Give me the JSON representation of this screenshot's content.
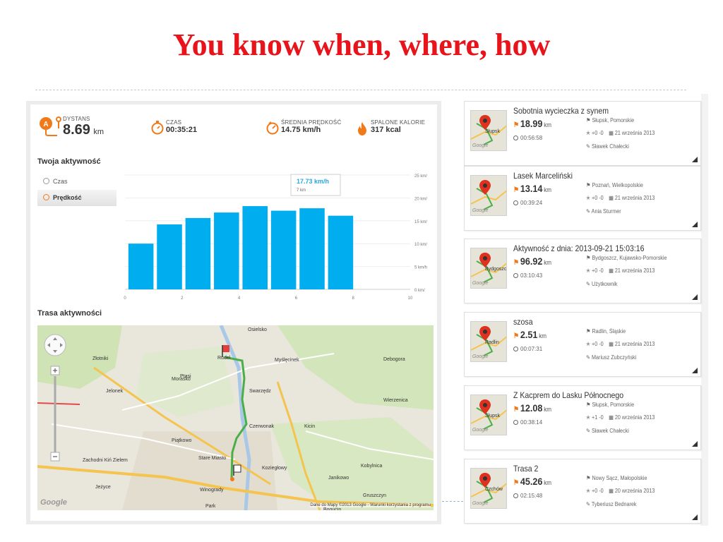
{
  "slide": {
    "title": "You know when, where, how"
  },
  "stats": {
    "distance": {
      "label": "DYSTANS",
      "value": "8.69",
      "unit": "km"
    },
    "time": {
      "label": "CZAS",
      "value": "00:35:21"
    },
    "avg_speed": {
      "label": "ŚREDNIA PRĘDKOŚĆ",
      "value": "14.75 km/h"
    },
    "calories": {
      "label": "SPALONE KALORIE",
      "value": "317 kcal"
    }
  },
  "activity": {
    "section_title": "Twoja aktywność",
    "tabs": [
      {
        "label": "Czas"
      },
      {
        "label": "Prędkość"
      }
    ]
  },
  "route": {
    "section_title": "Trasa aktywności"
  },
  "chart_data": {
    "type": "bar",
    "x": [
      1,
      2,
      3,
      4,
      5,
      6,
      7,
      8
    ],
    "values": [
      10,
      14.2,
      15.6,
      16.8,
      18.2,
      17.2,
      17.73,
      16.1
    ],
    "xticks": [
      "0",
      "2",
      "4",
      "6",
      "8",
      "10"
    ],
    "xlim": [
      0,
      10
    ],
    "yticks": [
      "0 km/",
      "5 km/h",
      "10 km/",
      "15 km/",
      "20 km/",
      "25 km/"
    ],
    "ylim": [
      0,
      25
    ],
    "color": "#00aeef",
    "tooltip": {
      "value": "17.73 km/h",
      "sub": "7 km"
    }
  },
  "map": {
    "places": [
      "Osielsko",
      "Złotniki",
      "Myślęcinek",
      "Rudel",
      "Ptasi",
      "Jeżyce",
      "Stare Miasto",
      "Czerwonak",
      "Kicin",
      "Wierzenica",
      "Koziegłowy",
      "Janikowo",
      "Kobylnica",
      "Gruszczyn",
      "Bogucin",
      "Swarzędz",
      "Debogora",
      "Morasko",
      "Jelonek",
      "Piątkowo",
      "Winogrady",
      "Park",
      "Zachodni Kiń Zielem"
    ],
    "attribution": "Dane do Mapy ©2013 Google - Warunki korzystania z programu",
    "google": "Google"
  },
  "activities": [
    {
      "title": "Sobotnia wycieczka z synem",
      "distance": "18.99",
      "unit": "km",
      "duration": "00:56:58",
      "location": "Słupsk, Pomorskie",
      "votes": "+0 -0",
      "date": "21 września 2013",
      "user": "Sławek Chałecki"
    },
    {
      "title": "Lasek Marceliński",
      "distance": "13.14",
      "unit": "km",
      "duration": "00:39:24",
      "location": "Poznań, Wielkopolskie",
      "votes": "+0 -0",
      "date": "21 września 2013",
      "user": "Ania Sturmer"
    },
    {
      "title": "Aktywność z dnia: 2013-09-21 15:03:16",
      "distance": "96.92",
      "unit": "km",
      "duration": "03:10:43",
      "location": "Bydgoszcz, Kujawsko-Pomorskie",
      "votes": "+0 -0",
      "date": "21 września 2013",
      "user": "Użytkownik"
    },
    {
      "title": "szosa",
      "distance": "2.51",
      "unit": "km",
      "duration": "00:07:31",
      "location": "Radlin, Śląskie",
      "votes": "+0 -0",
      "date": "21 września 2013",
      "user": "Mariusz Zubczyński"
    },
    {
      "title": "Z Kacprem do Lasku Północnego",
      "distance": "12.08",
      "unit": "km",
      "duration": "00:38:14",
      "location": "Słupsk, Pomorskie",
      "votes": "+1 -0",
      "date": "20 września 2013",
      "user": "Sławek Chałecki"
    },
    {
      "title": "Trasa 2",
      "distance": "45.26",
      "unit": "km",
      "duration": "02:15:48",
      "location": "Nowy Sącz, Małopolskie",
      "votes": "+0 -0",
      "date": "20 września 2013",
      "user": "Tyberiusz Bednarek"
    }
  ],
  "thumb_labels": [
    "Słupsk",
    "",
    "Bydgoszcz",
    "Radlin",
    "Słupsk",
    "Czchów"
  ]
}
